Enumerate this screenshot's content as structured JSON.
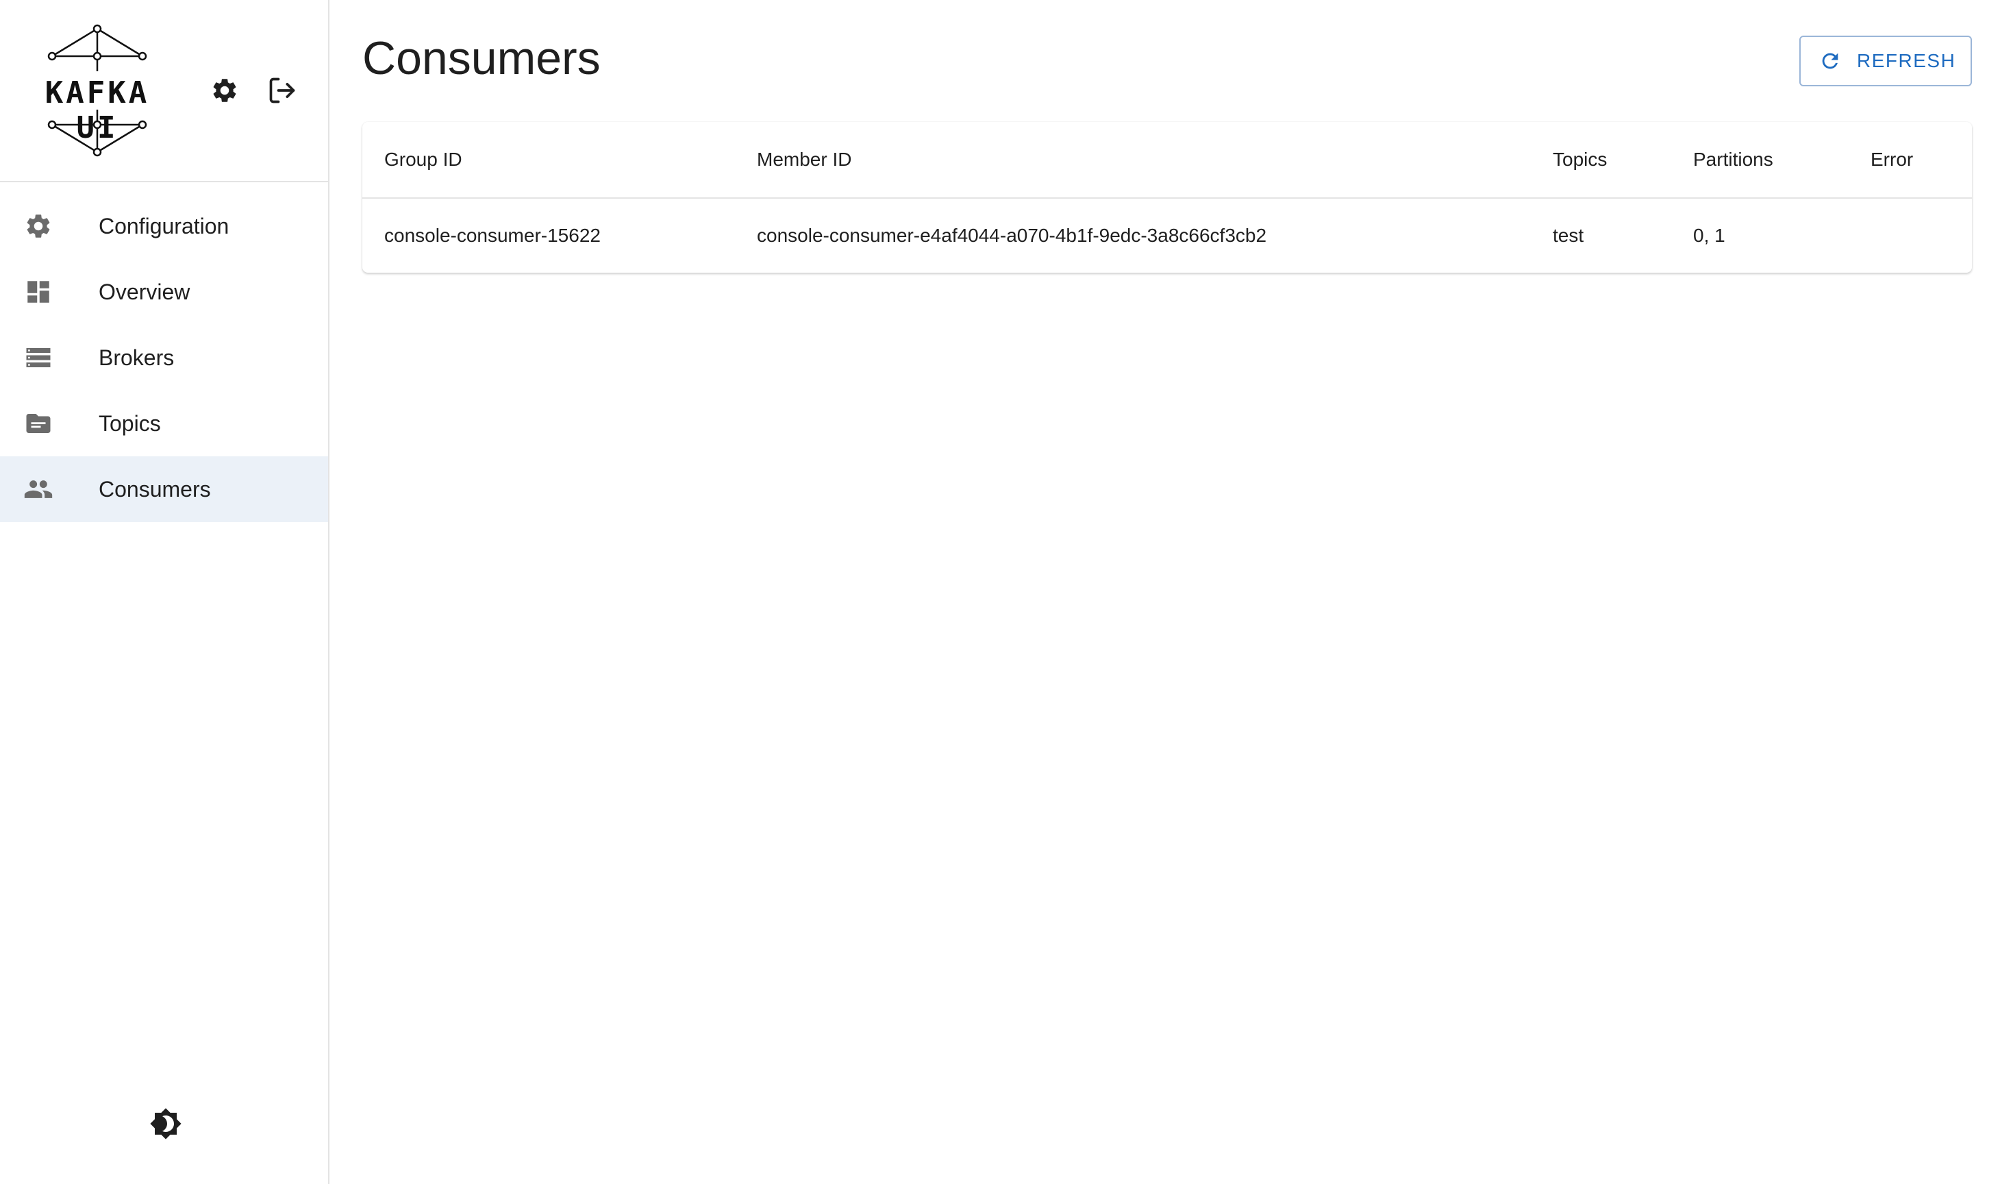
{
  "app": {
    "logo_text": "KAFKA UI"
  },
  "sidebar": {
    "header_icons": [
      {
        "name": "gear-icon"
      },
      {
        "name": "logout-icon"
      }
    ],
    "items": [
      {
        "label": "Configuration",
        "icon": "gear-icon",
        "active": false
      },
      {
        "label": "Overview",
        "icon": "dashboard-icon",
        "active": false
      },
      {
        "label": "Brokers",
        "icon": "server-list-icon",
        "active": false
      },
      {
        "label": "Topics",
        "icon": "topic-folder-icon",
        "active": false
      },
      {
        "label": "Consumers",
        "icon": "people-icon",
        "active": true
      }
    ],
    "theme_toggle_icon": "brightness-icon"
  },
  "main": {
    "title": "Consumers",
    "refresh_label": "REFRESH",
    "table": {
      "columns": [
        "Group ID",
        "Member ID",
        "Topics",
        "Partitions",
        "Error"
      ],
      "rows": [
        [
          "console-consumer-15622",
          "console-consumer-e4af4044-a070-4b1f-9edc-3a8c66cf3cb2",
          "test",
          "0, 1",
          ""
        ]
      ]
    }
  },
  "colors": {
    "accent": "#1e6bc0",
    "active_bg": "#ebf1f8",
    "icon_gray": "#6b6b6b"
  }
}
